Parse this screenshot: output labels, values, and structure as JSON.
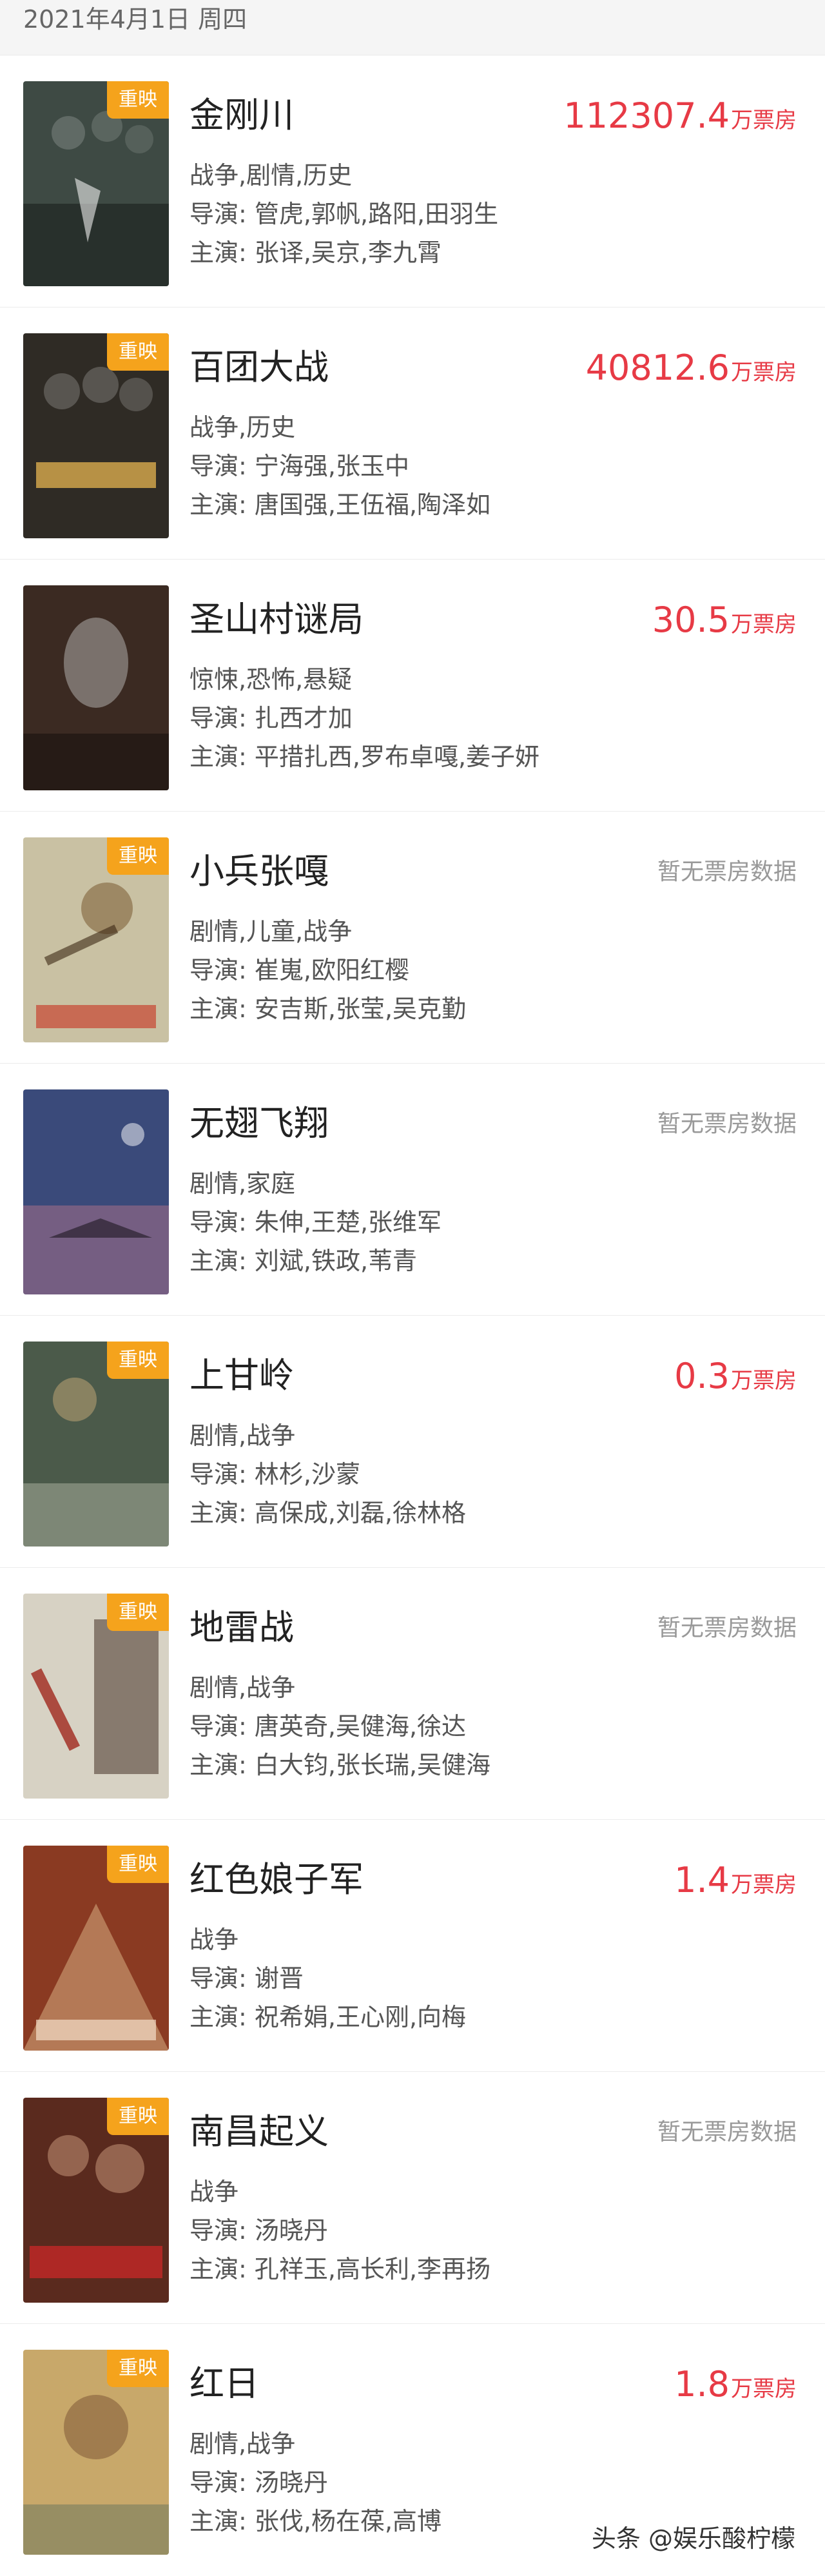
{
  "header": {
    "date": "2021年4月1日 周四"
  },
  "labels": {
    "director_prefix": "导演: ",
    "cast_prefix": "主演: ",
    "unit": "万票房"
  },
  "movies": [
    {
      "title": "金刚川",
      "badge": "重映",
      "box_office": "112307.4",
      "box_unit": "万票房",
      "genre": "战争,剧情,历史",
      "director": "导演: 管虎,郭帆,路阳,田羽生",
      "cast": "主演: 张译,吴京,李九霄",
      "poster_color": "#3e4a44"
    },
    {
      "title": "百团大战",
      "badge": "重映",
      "box_office": "40812.6",
      "box_unit": "万票房",
      "genre": "战争,历史",
      "director": "导演: 宁海强,张玉中",
      "cast": "主演: 唐国强,王伍福,陶泽如",
      "poster_color": "#2f2b25"
    },
    {
      "title": "圣山村谜局",
      "badge": "",
      "box_office": "30.5",
      "box_unit": "万票房",
      "genre": "惊悚,恐怖,悬疑",
      "director": "导演: 扎西才加",
      "cast": "主演: 平措扎西,罗布卓嘎,姜子妍",
      "poster_color": "#3b2a22"
    },
    {
      "title": "小兵张嘎",
      "badge": "重映",
      "box_office": "",
      "box_none": "暂无票房数据",
      "box_unit": "",
      "genre": "剧情,儿童,战争",
      "director": "导演: 崔嵬,欧阳红樱",
      "cast": "主演: 安吉斯,张莹,吴克勤",
      "poster_color": "#c9c1a3"
    },
    {
      "title": "无翅飞翔",
      "badge": "",
      "box_office": "",
      "box_none": "暂无票房数据",
      "box_unit": "",
      "genre": "剧情,家庭",
      "director": "导演: 朱伸,王楚,张维军",
      "cast": "主演: 刘斌,铁政,苇青",
      "poster_color": "#3a4a7a"
    },
    {
      "title": "上甘岭",
      "badge": "重映",
      "box_office": "0.3",
      "box_unit": "万票房",
      "genre": "剧情,战争",
      "director": "导演: 林杉,沙蒙",
      "cast": "主演: 高保成,刘磊,徐林格",
      "poster_color": "#4b5a4a"
    },
    {
      "title": "地雷战",
      "badge": "重映",
      "box_office": "",
      "box_none": "暂无票房数据",
      "box_unit": "",
      "genre": "剧情,战争",
      "director": "导演: 唐英奇,吴健海,徐达",
      "cast": "主演: 白大钧,张长瑞,吴健海",
      "poster_color": "#d7d2c4"
    },
    {
      "title": "红色娘子军",
      "badge": "重映",
      "box_office": "1.4",
      "box_unit": "万票房",
      "genre": "战争",
      "director": "导演: 谢晋",
      "cast": "主演: 祝希娟,王心刚,向梅",
      "poster_color": "#8a3a22"
    },
    {
      "title": "南昌起义",
      "badge": "重映",
      "box_office": "",
      "box_none": "暂无票房数据",
      "box_unit": "",
      "genre": "战争",
      "director": "导演: 汤晓丹",
      "cast": "主演: 孔祥玉,高长利,李再扬",
      "poster_color": "#5a2a1e"
    },
    {
      "title": "红日",
      "badge": "重映",
      "box_office": "1.8",
      "box_unit": "万票房",
      "genre": "剧情,战争",
      "director": "导演: 汤晓丹",
      "cast": "主演: 张伐,杨在葆,高博",
      "poster_color": "#c8a86a"
    }
  ],
  "watermark": "头条 @娱乐酸柠檬"
}
